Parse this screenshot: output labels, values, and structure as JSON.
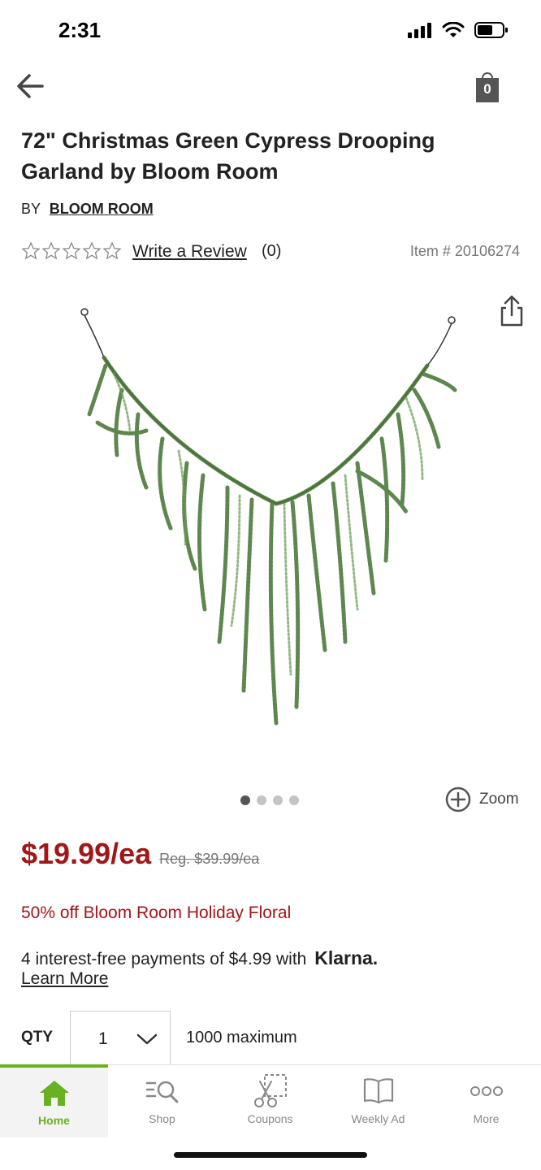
{
  "status_bar": {
    "time": "2:31"
  },
  "header": {
    "cart_count": "0"
  },
  "product": {
    "title": "72\" Christmas Green Cypress Drooping Garland by Bloom Room",
    "by_prefix": "BY",
    "brand": "BLOOM ROOM",
    "rating": 0,
    "rating_max": 5,
    "write_review": "Write a Review",
    "review_count": "(0)",
    "item_number": "Item # 20106274",
    "image_count": 4,
    "active_image": 1,
    "zoom_label": "Zoom",
    "price": "$19.99/ea",
    "reg_price": "Reg. $39.99/ea",
    "promo": "50% off Bloom Room Holiday Floral",
    "klarna_text": "4 interest-free payments of $4.99 with",
    "klarna_brand": "Klarna.",
    "learn_more": "Learn More",
    "qty_label": "QTY",
    "qty_value": "1",
    "qty_max": "1000 maximum"
  },
  "tabs": [
    {
      "label": "Home",
      "icon": "home-icon",
      "active": true
    },
    {
      "label": "Shop",
      "icon": "shop-search-icon",
      "active": false
    },
    {
      "label": "Coupons",
      "icon": "scissors-coupon-icon",
      "active": false
    },
    {
      "label": "Weekly Ad",
      "icon": "open-book-icon",
      "active": false
    },
    {
      "label": "More",
      "icon": "more-dots-icon",
      "active": false
    }
  ],
  "colors": {
    "price_red": "#a21618",
    "brand_green": "#6ab023",
    "icon_gray": "#555555"
  }
}
